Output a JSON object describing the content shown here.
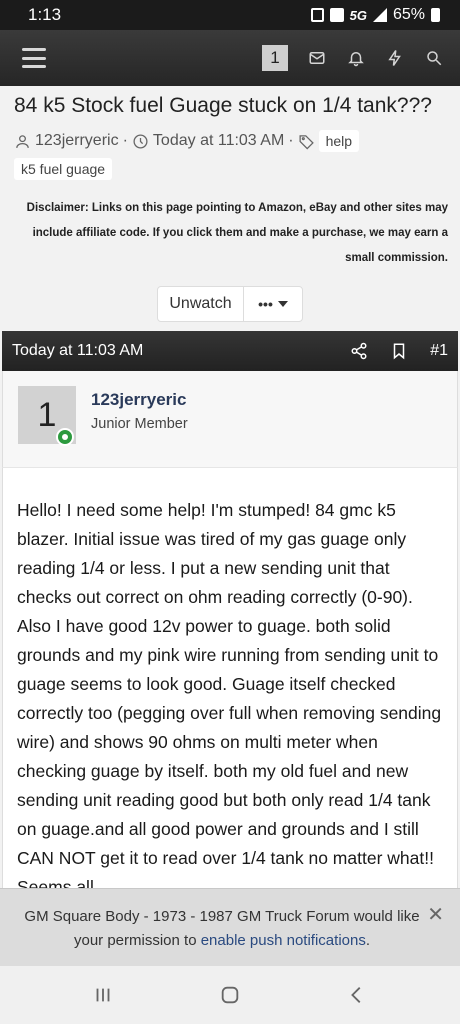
{
  "status_bar": {
    "time": "1:13",
    "network": "5G",
    "battery": "65%"
  },
  "header": {
    "notification_count": "1"
  },
  "thread": {
    "title": "84 k5 Stock fuel Guage stuck on 1/4 tank???",
    "author": "123jerryeric",
    "separator": "·",
    "date": "Today at 11:03 AM",
    "tags": [
      "help",
      "k5 fuel guage"
    ]
  },
  "disclaimer": "Disclaimer: Links on this page pointing to Amazon, eBay and other sites may include affiliate code. If you click them and make a purchase, we may earn a small commission.",
  "buttons": {
    "unwatch": "Unwatch",
    "more": "•••"
  },
  "post": {
    "date": "Today at 11:03 AM",
    "number": "#1",
    "avatar_letter": "1",
    "username": "123jerryeric",
    "user_title": "Junior Member",
    "text": "Hello! I need some help! I'm stumped! 84 gmc k5 blazer. Initial issue was tired of my gas guage only reading 1/4 or less. I put a new sending unit that checks out correct on ohm reading correctly (0-90). Also I have good 12v power to guage. both solid grounds and my pink wire running from sending unit to guage seems to look good. Guage itself checked correctly too (pegging over full when removing sending wire) and shows 90 ohms on multi meter when checking guage by itself. both my old fuel and new sending unit reading good but both only read 1/4 tank on guage.and all good power and grounds and I still CAN NOT get it to read over 1/4 tank no matter what!! Seems all"
  },
  "push_banner": {
    "text": "GM Square Body - 1973 - 1987 GM Truck Forum would like your permission to",
    "link": "enable push notifications",
    "suffix": ".",
    "close": "✕"
  }
}
